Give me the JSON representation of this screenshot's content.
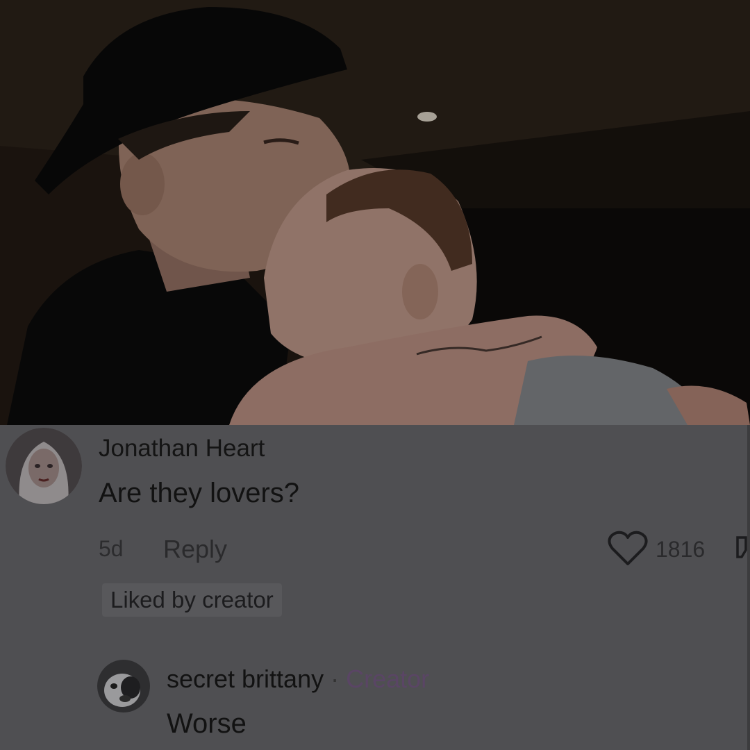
{
  "comment": {
    "username": "Jonathan Heart",
    "text": "Are they lovers?",
    "time": "5d",
    "reply_label": "Reply",
    "like_count": "1816",
    "liked_badge": "Liked by creator"
  },
  "reply": {
    "username": "secret brittany",
    "separator": "·",
    "badge": "Creator",
    "text": "Worse"
  },
  "icons": {
    "like": "heart-icon",
    "dislike": "dislike-icon"
  }
}
